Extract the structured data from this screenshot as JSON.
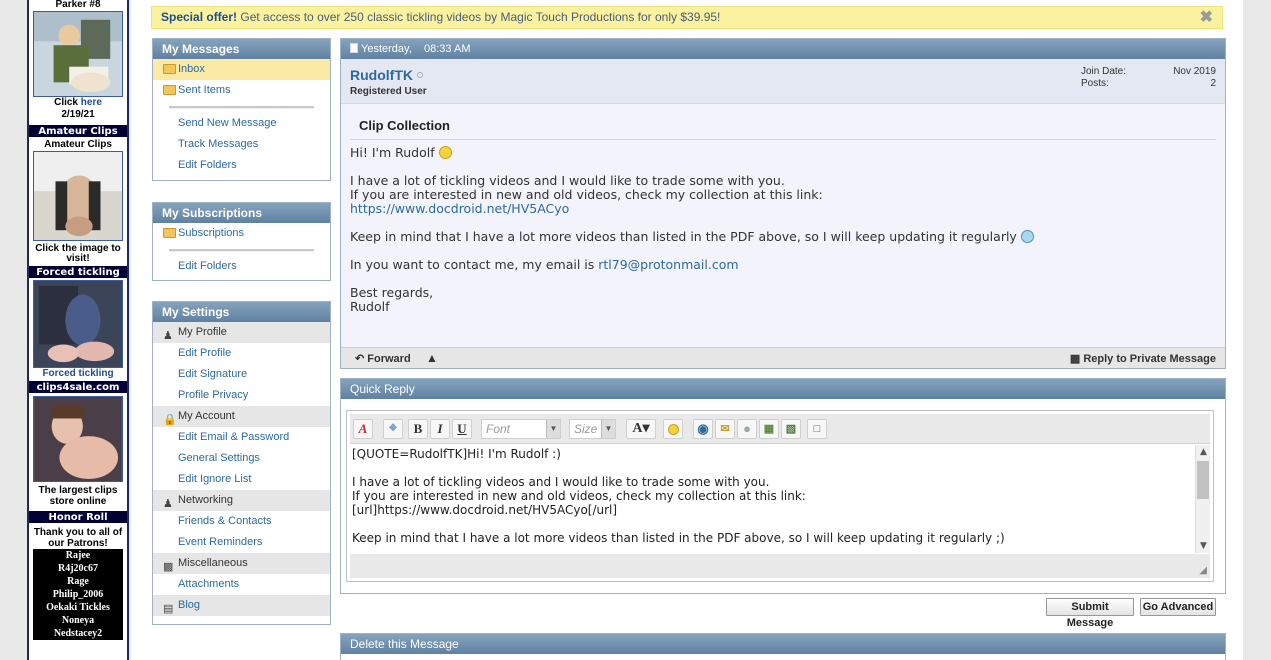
{
  "ads": {
    "parker_title": "Parker #8",
    "parker_click": "Click",
    "parker_here": "here",
    "parker_date": "2/19/21",
    "amateur_bar": "Amateur Clips",
    "amateur_title": "Amateur Clips",
    "amateur_caption": "Click the image to visit!",
    "forced_bar": "Forced tickling",
    "forced_caption": "Forced tickling",
    "c4s_bar": "clips4sale.com",
    "c4s_caption": "The largest clips store online",
    "honor_bar": "Honor Roll",
    "honor_thanks": "Thank you to all of our Patrons!",
    "honor_names": [
      "Rajee",
      "R4j20c67",
      "Rage",
      "Philip_2006",
      "Oekaki Tickles",
      "Noneya",
      "Nedstacey2"
    ]
  },
  "offer": {
    "strong": "Special offer!",
    "text": " Get access to over 250 classic tickling videos by Magic Touch Productions for only $39.95!",
    "close": "✖"
  },
  "sidebar": {
    "messages": {
      "title": "My Messages",
      "inbox": "Inbox",
      "sent": "Sent Items",
      "send_new": "Send New Message",
      "track": "Track Messages",
      "edit_folders": "Edit Folders"
    },
    "subscriptions": {
      "title": "My Subscriptions",
      "subs": "Subscriptions",
      "edit_folders": "Edit Folders"
    },
    "settings": {
      "title": "My Settings",
      "profile": "My Profile",
      "edit_profile": "Edit Profile",
      "edit_signature": "Edit Signature",
      "profile_privacy": "Profile Privacy",
      "account": "My Account",
      "edit_email": "Edit Email & Password",
      "general": "General Settings",
      "ignore": "Edit Ignore List",
      "networking": "Networking",
      "friends": "Friends & Contacts",
      "events": "Event Reminders",
      "misc": "Miscellaneous",
      "attachments": "Attachments",
      "blog": "Blog"
    }
  },
  "message": {
    "date": "Yesterday,",
    "time": "08:33 AM",
    "username": "RudolfTK",
    "usertitle": "Registered User",
    "join_label": "Join Date:",
    "join_value": "Nov 2019",
    "posts_label": "Posts:",
    "posts_value": "2",
    "title": "Clip Collection",
    "greeting": "Hi! I'm Rudolf",
    "line1": "I have a lot of tickling videos and I would like to trade some with you.",
    "line2": "If you are interested in new and old videos, check my collection at this link:",
    "link": "https://www.docdroid.net/HV5ACyo",
    "line3": "Keep in mind that I have a lot more videos than listed in the PDF above, so I will keep updating it regularly",
    "contact_pre": "In you want to contact me, my email is ",
    "email": "rtl79@protonmail.com",
    "regards": "Best regards,",
    "sign": "Rudolf",
    "forward": "Forward",
    "reply": "Reply to Private Message"
  },
  "quickreply": {
    "title": "Quick Reply",
    "font_placeholder": "Font",
    "size_placeholder": "Size",
    "text_lines": [
      "[QUOTE=RudolfTK]Hi! I'm Rudolf :)",
      "",
      "I have a lot of tickling videos and I would like to trade some with you.",
      "If you are interested in new and old videos, check my collection at this link:",
      "[url]https://www.docdroid.net/HV5ACyo[/url]",
      "",
      "Keep in mind that I have a lot more videos than listed in the PDF above, so I will keep updating it regularly ;)"
    ],
    "submit": "Submit Message",
    "advanced": "Go Advanced"
  },
  "delete": {
    "title": "Delete this Message"
  }
}
